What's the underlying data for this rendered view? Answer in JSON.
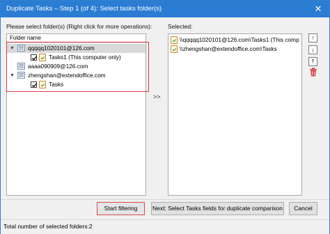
{
  "window": {
    "title": "Duplicate Tasks – Step 1 (of 4): Select tasks folder(s)",
    "close_glyph": "✕"
  },
  "left": {
    "instruction": "Please select folder(s) (Right click for more operations):",
    "column_header": "Folder name",
    "tree": [
      {
        "label": "qqqqq1020101@126.com",
        "type": "account",
        "expanded": true
      },
      {
        "label": "Tasks1 (This computer only)",
        "type": "tasks",
        "checked": true
      },
      {
        "label": "aaaa090909@126.com",
        "type": "account",
        "expanded": false
      },
      {
        "label": "zhengshan@extendoffice.com",
        "type": "account",
        "expanded": true
      },
      {
        "label": "Tasks",
        "type": "tasks",
        "checked": true
      }
    ]
  },
  "middle": {
    "arrows": ">>"
  },
  "right": {
    "label": "Selected:",
    "items": [
      "\\\\qqqqq1020101@126.com\\Tasks1 (This comp",
      "\\\\zhengshan@extendoffice.com\\Tasks"
    ],
    "buttons": {
      "up": "↑",
      "down": "↓",
      "top": "⤒"
    }
  },
  "buttons": {
    "start": "Start filtering",
    "next": "Next: Select Tasks fields for duplicate comparison",
    "cancel": "Cancel"
  },
  "status": {
    "text": "Total number of selected folders:2"
  },
  "colors": {
    "titlebar": "#2b7cd3",
    "highlight": "#d9393f",
    "trash": "#d23a3a"
  }
}
